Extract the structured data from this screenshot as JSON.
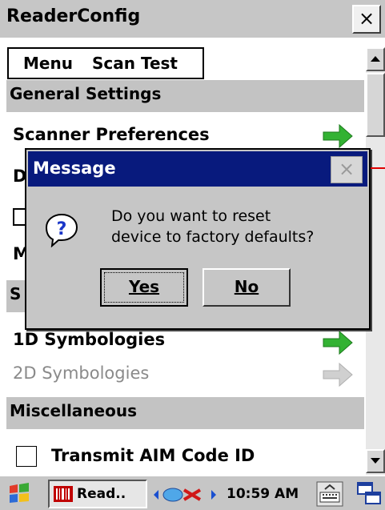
{
  "window": {
    "title": "ReaderConfig",
    "close_glyph": "×"
  },
  "menubar": {
    "menu": "Menu",
    "scan_test": "Scan Test"
  },
  "sections": {
    "general": "General Settings",
    "symbologies": "S",
    "misc": "Miscellaneous"
  },
  "rows": {
    "scanner_preferences": "Scanner Preferences",
    "row_d": "D",
    "row_m": "M",
    "symbologies_1d": "1D Symbologies",
    "symbologies_2d": "2D Symbologies",
    "transmit_aim": "Transmit AIM Code ID"
  },
  "dialog": {
    "title": "Message",
    "close_glyph": "×",
    "line1": "Do you want to reset",
    "line2": "device to factory defaults?",
    "yes": "Yes",
    "no": "No"
  },
  "taskbar": {
    "app_label": "Read..",
    "time": "10:59 AM"
  },
  "colors": {
    "dialog_title_bg": "#081a7d",
    "section_bg": "#c3c3c3",
    "arrow_green": "#33b233",
    "arrow_gray": "#c8c8c8"
  },
  "icons": [
    "windows-flag-icon",
    "reader-app-icon",
    "network-icon",
    "sync-icon",
    "keyboard-icon",
    "window-switch-icon",
    "question-icon",
    "green-arrow-icon"
  ]
}
